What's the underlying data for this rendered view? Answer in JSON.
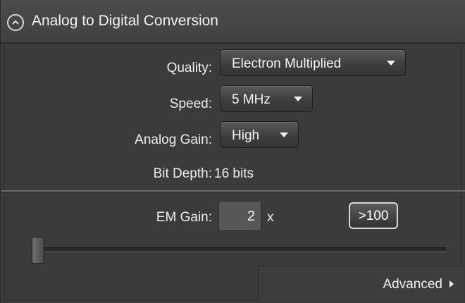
{
  "header": {
    "title": "Analog to Digital Conversion",
    "collapse_icon": "chevron-up-circle-icon"
  },
  "quality": {
    "label": "Quality:",
    "value": "Electron Multiplied"
  },
  "speed": {
    "label": "Speed:",
    "value": "5 MHz"
  },
  "analog_gain": {
    "label": "Analog Gain:",
    "value": "High"
  },
  "bit_depth": {
    "label": "Bit Depth:",
    "value": "16 bits"
  },
  "em_gain": {
    "label": "EM Gain:",
    "value": "2",
    "unit": "x",
    "boost_label": ">100",
    "slider_fraction": 0.0
  },
  "advanced": {
    "label": "Advanced",
    "icon": "chevron-right-icon"
  },
  "colors": {
    "background": "#3b3b3b",
    "text": "#ececec"
  }
}
